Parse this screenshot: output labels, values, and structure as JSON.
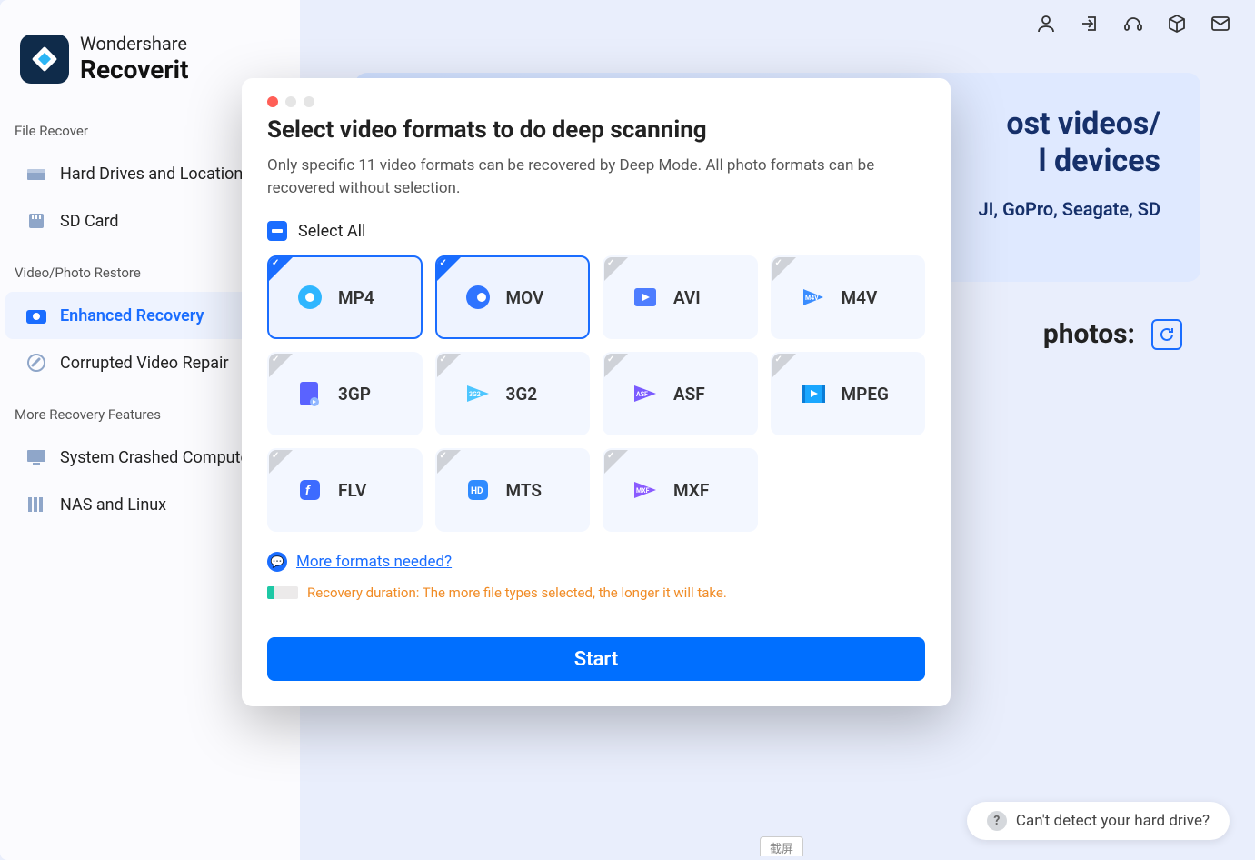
{
  "brand": {
    "top": "Wondershare",
    "name": "Recoverit"
  },
  "sidebar": {
    "section1": "File Recover",
    "items1": [
      {
        "label": "Hard Drives and Locations"
      },
      {
        "label": "SD Card"
      }
    ],
    "section2": "Video/Photo Restore",
    "items2": [
      {
        "label": "Enhanced Recovery"
      },
      {
        "label": "Corrupted Video Repair"
      }
    ],
    "section3": "More Recovery Features",
    "items3": [
      {
        "label": "System Crashed Computer"
      },
      {
        "label": "NAS and Linux"
      }
    ]
  },
  "banner": {
    "title_frag": "ost videos/\nl devices",
    "sub_frag": "JI, GoPro, Seagate, SD"
  },
  "photos_row": "photos:",
  "dialog": {
    "title": "Select video formats to do deep scanning",
    "desc": "Only specific 11 video formats can be recovered by Deep Mode. All photo formats can be recovered without selection.",
    "select_all": "Select All",
    "formats": [
      {
        "name": "MP4",
        "selected": true
      },
      {
        "name": "MOV",
        "selected": true
      },
      {
        "name": "AVI",
        "selected": false
      },
      {
        "name": "M4V",
        "selected": false
      },
      {
        "name": "3GP",
        "selected": false
      },
      {
        "name": "3G2",
        "selected": false
      },
      {
        "name": "ASF",
        "selected": false
      },
      {
        "name": "MPEG",
        "selected": false
      },
      {
        "name": "FLV",
        "selected": false
      },
      {
        "name": "MTS",
        "selected": false
      },
      {
        "name": "MXF",
        "selected": false
      }
    ],
    "more_link": "More formats needed?",
    "duration_note": "Recovery duration: The more file types selected, the longer it will take.",
    "start": "Start"
  },
  "help_pill": "Can't detect your hard drive?",
  "snippet_label": "截屏"
}
